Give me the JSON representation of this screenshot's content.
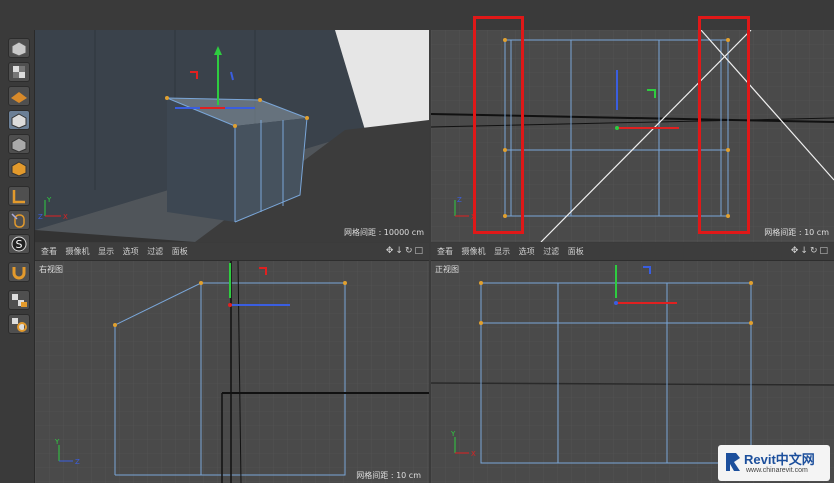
{
  "toolbar": {
    "icons": [
      "cube-icon",
      "checker-icon",
      "texture-icon",
      "model-icon",
      "object-icon",
      "polygon-icon",
      "axis-icon",
      "mouse-icon",
      "snap-icon",
      "magnet-icon",
      "lock-grid-icon",
      "workplane-icon"
    ],
    "snap_label": "S"
  },
  "viewport_menu": [
    "查看",
    "摄像机",
    "显示",
    "选项",
    "过滤",
    "面板"
  ],
  "viewports": {
    "perspective": {
      "grid": "网格间距 : 10000 cm"
    },
    "top": {
      "grid": "网格间距 : 10 cm"
    },
    "right": {
      "title": "右视图",
      "grid": "网格间距 : 10 cm"
    },
    "front": {
      "title": "正视图"
    }
  },
  "axis": {
    "y": "Y",
    "x": "X",
    "z": "Z"
  },
  "colors": {
    "highlight": "#e01818",
    "wire": "#7aa6d8",
    "point": "#e0a030"
  },
  "logo": {
    "brand": "Revit中文网",
    "url": "www.chinarevit.com"
  }
}
